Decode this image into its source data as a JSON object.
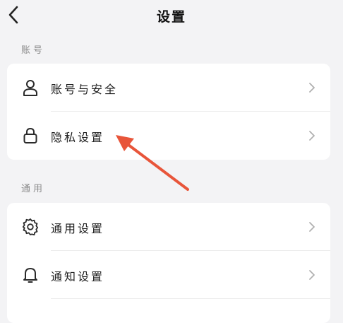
{
  "header": {
    "title": "设置",
    "back_icon": "chevron-left-icon"
  },
  "sections": [
    {
      "label": "账号",
      "items": [
        {
          "label": "账号与安全",
          "icon": "user-icon"
        },
        {
          "label": "隐私设置",
          "icon": "lock-icon"
        }
      ]
    },
    {
      "label": "通用",
      "items": [
        {
          "label": "通用设置",
          "icon": "gear-icon"
        },
        {
          "label": "通知设置",
          "icon": "bell-icon"
        }
      ]
    }
  ],
  "annotation": {
    "color": "#e8553a",
    "points_to": "隐私设置"
  },
  "colors": {
    "background": "#f3f3f5",
    "card": "#ffffff",
    "section_label": "#8a8a8a",
    "chevron": "#b0b0b0"
  }
}
